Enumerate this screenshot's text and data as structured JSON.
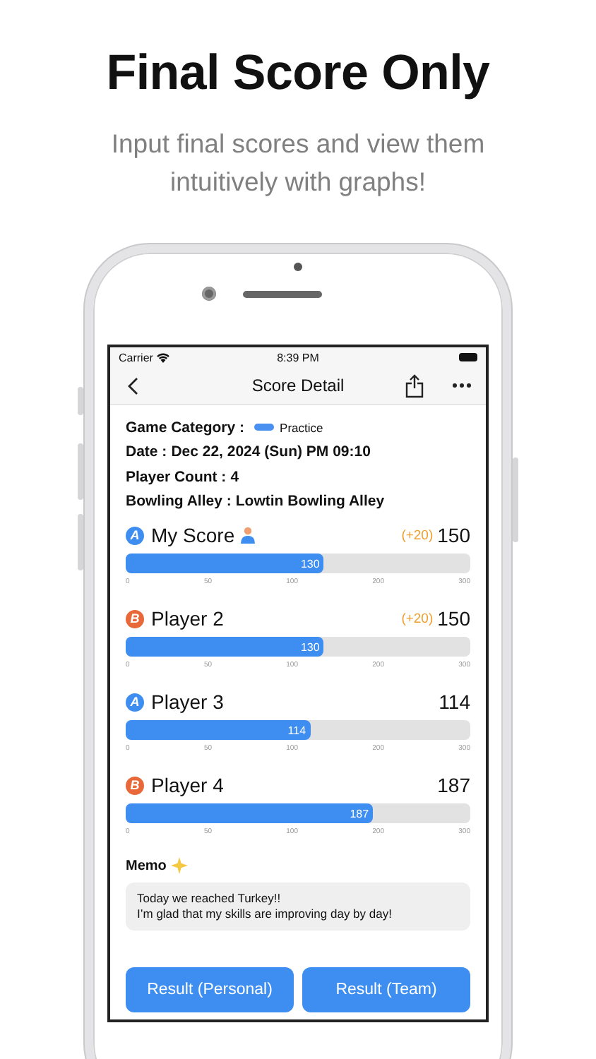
{
  "headline": "Final Score Only",
  "subtitle": "Input final scores and view them intuitively with graphs!",
  "status_bar": {
    "carrier": "Carrier",
    "time": "8:39 PM"
  },
  "nav": {
    "title": "Score Detail"
  },
  "info": [
    {
      "kind": "tag",
      "label": "Game Category :",
      "value": "Practice",
      "color": "#4a90f0"
    },
    {
      "kind": "text",
      "label": "Date :",
      "value": "Dec 22, 2024 (Sun) PM 09:10"
    },
    {
      "kind": "text",
      "label": "Player Count :",
      "value": "4"
    },
    {
      "kind": "text",
      "label": "Bowling Alley :",
      "value": "Lowtin Bowling Alley"
    }
  ],
  "players": [
    {
      "badge": "A",
      "color": "#3d8ef0",
      "name": "My Score",
      "is_me": true,
      "bonus": "(+20)",
      "total": "150",
      "bar_value": "130",
      "level": 0.575,
      "ticks": [
        "0",
        "50",
        "100",
        "200",
        "300"
      ]
    },
    {
      "badge": "B",
      "color": "#e8683a",
      "name": "Player 2",
      "is_me": false,
      "bonus": "(+20)",
      "total": "150",
      "bar_value": "130",
      "level": 0.575,
      "ticks": [
        "0",
        "50",
        "100",
        "200",
        "300"
      ]
    },
    {
      "badge": "A",
      "color": "#3d8ef0",
      "name": "Player 3",
      "is_me": false,
      "total": "114",
      "bar_value": "114",
      "level": 0.535,
      "ticks": [
        "0",
        "50",
        "100",
        "200",
        "300"
      ]
    },
    {
      "badge": "B",
      "color": "#e8683a",
      "name": "Player 4",
      "is_me": false,
      "total": "187",
      "bar_value": "187",
      "level": 0.7175,
      "ticks": [
        "0",
        "50",
        "100",
        "200",
        "300"
      ]
    }
  ],
  "memo": {
    "title": "Memo",
    "lines": [
      "Today we reached Turkey!!",
      "I’m glad that my skills are improving day by day!"
    ]
  },
  "buttons": [
    "Result (Personal)",
    "Result (Team)"
  ]
}
